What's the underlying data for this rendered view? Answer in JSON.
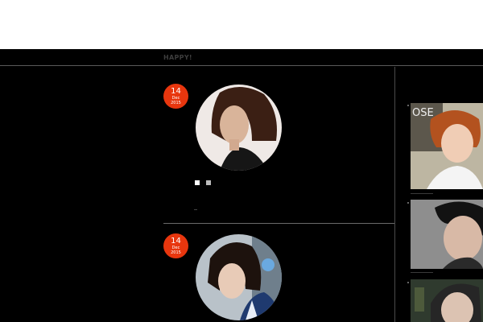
{
  "nav": {
    "title": "HAPPY!"
  },
  "posts": [
    {
      "day": "14",
      "month": "Dec",
      "year": "2015"
    },
    {
      "day": "14",
      "month": "Dec",
      "year": "2015"
    }
  ],
  "sidebar": {
    "thumbnails": [
      {
        "sign_text": "OSE"
      },
      {
        "sign_text": ""
      },
      {
        "sign_text": ""
      }
    ]
  },
  "colors": {
    "accent": "#e8360e",
    "background": "#000000",
    "header": "#ffffff"
  },
  "icons": {
    "pager": "square-dot-icon"
  }
}
